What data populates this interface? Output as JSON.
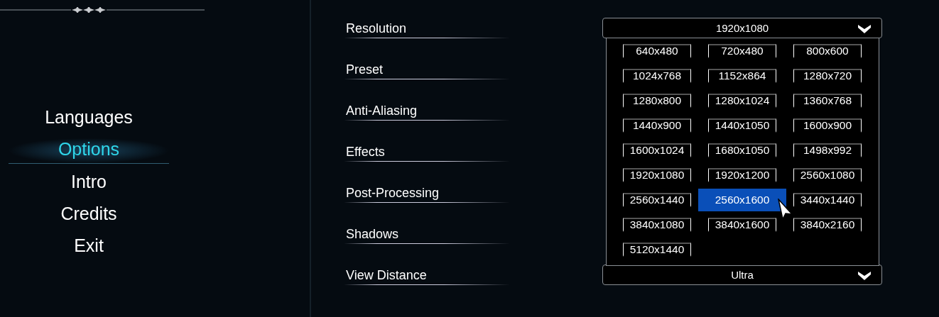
{
  "menu": [
    {
      "label": "Languages",
      "selected": false
    },
    {
      "label": "Options",
      "selected": true
    },
    {
      "label": "Intro",
      "selected": false
    },
    {
      "label": "Credits",
      "selected": false
    },
    {
      "label": "Exit",
      "selected": false
    }
  ],
  "settings": [
    {
      "label": "Resolution",
      "value": "1920x1080"
    },
    {
      "label": "Preset"
    },
    {
      "label": "Anti-Aliasing"
    },
    {
      "label": "Effects"
    },
    {
      "label": "Post-Processing"
    },
    {
      "label": "Shadows"
    },
    {
      "label": "View Distance",
      "value": "Ultra"
    }
  ],
  "resolution_options": [
    {
      "label": "640x480",
      "selected": false
    },
    {
      "label": "720x480",
      "selected": false
    },
    {
      "label": "800x600",
      "selected": false
    },
    {
      "label": "1024x768",
      "selected": false
    },
    {
      "label": "1152x864",
      "selected": false
    },
    {
      "label": "1280x720",
      "selected": false
    },
    {
      "label": "1280x800",
      "selected": false
    },
    {
      "label": "1280x1024",
      "selected": false
    },
    {
      "label": "1360x768",
      "selected": false
    },
    {
      "label": "1440x900",
      "selected": false
    },
    {
      "label": "1440x1050",
      "selected": false
    },
    {
      "label": "1600x900",
      "selected": false
    },
    {
      "label": "1600x1024",
      "selected": false
    },
    {
      "label": "1680x1050",
      "selected": false
    },
    {
      "label": "1498x992",
      "selected": false
    },
    {
      "label": "1920x1080",
      "selected": false
    },
    {
      "label": "1920x1200",
      "selected": false
    },
    {
      "label": "2560x1080",
      "selected": false
    },
    {
      "label": "2560x1440",
      "selected": false
    },
    {
      "label": "2560x1600",
      "selected": true
    },
    {
      "label": "3440x1440",
      "selected": false
    },
    {
      "label": "3840x1080",
      "selected": false
    },
    {
      "label": "3840x1600",
      "selected": false
    },
    {
      "label": "3840x2160",
      "selected": false
    },
    {
      "label": "5120x1440",
      "selected": false
    }
  ]
}
